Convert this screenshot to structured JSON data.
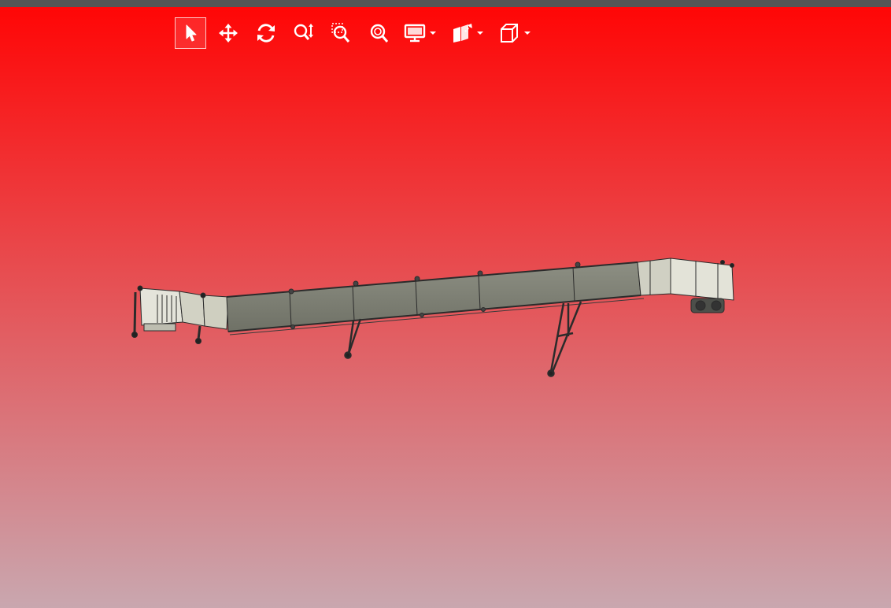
{
  "colors": {
    "background_top": "#ff0606",
    "background_bottom": "#c9a7af",
    "top_strip": "#555555",
    "model_panel": "#7b7d72",
    "model_panel_light": "#d8d8cc",
    "model_outline": "#2b2b2b",
    "icon": "#ffffff"
  },
  "toolbar": {
    "tools": [
      {
        "id": "select",
        "icon": "arrow-cursor-icon",
        "active": true
      },
      {
        "id": "pan",
        "icon": "move-arrows-icon",
        "active": false
      },
      {
        "id": "rotate",
        "icon": "rotate-icon",
        "active": false
      },
      {
        "id": "zoom",
        "icon": "zoom-updown-icon",
        "active": false
      },
      {
        "id": "zoom-window",
        "icon": "zoom-window-icon",
        "active": false
      },
      {
        "id": "zoom-fit",
        "icon": "zoom-fit-icon",
        "active": false
      },
      {
        "id": "display-mode",
        "icon": "monitor-icon",
        "dropdown": true
      },
      {
        "id": "explode",
        "icon": "explode-icon",
        "dropdown": true
      },
      {
        "id": "views",
        "icon": "cube-icon",
        "dropdown": true
      }
    ]
  },
  "model": {
    "kind": "3d-conveyor-assembly"
  }
}
